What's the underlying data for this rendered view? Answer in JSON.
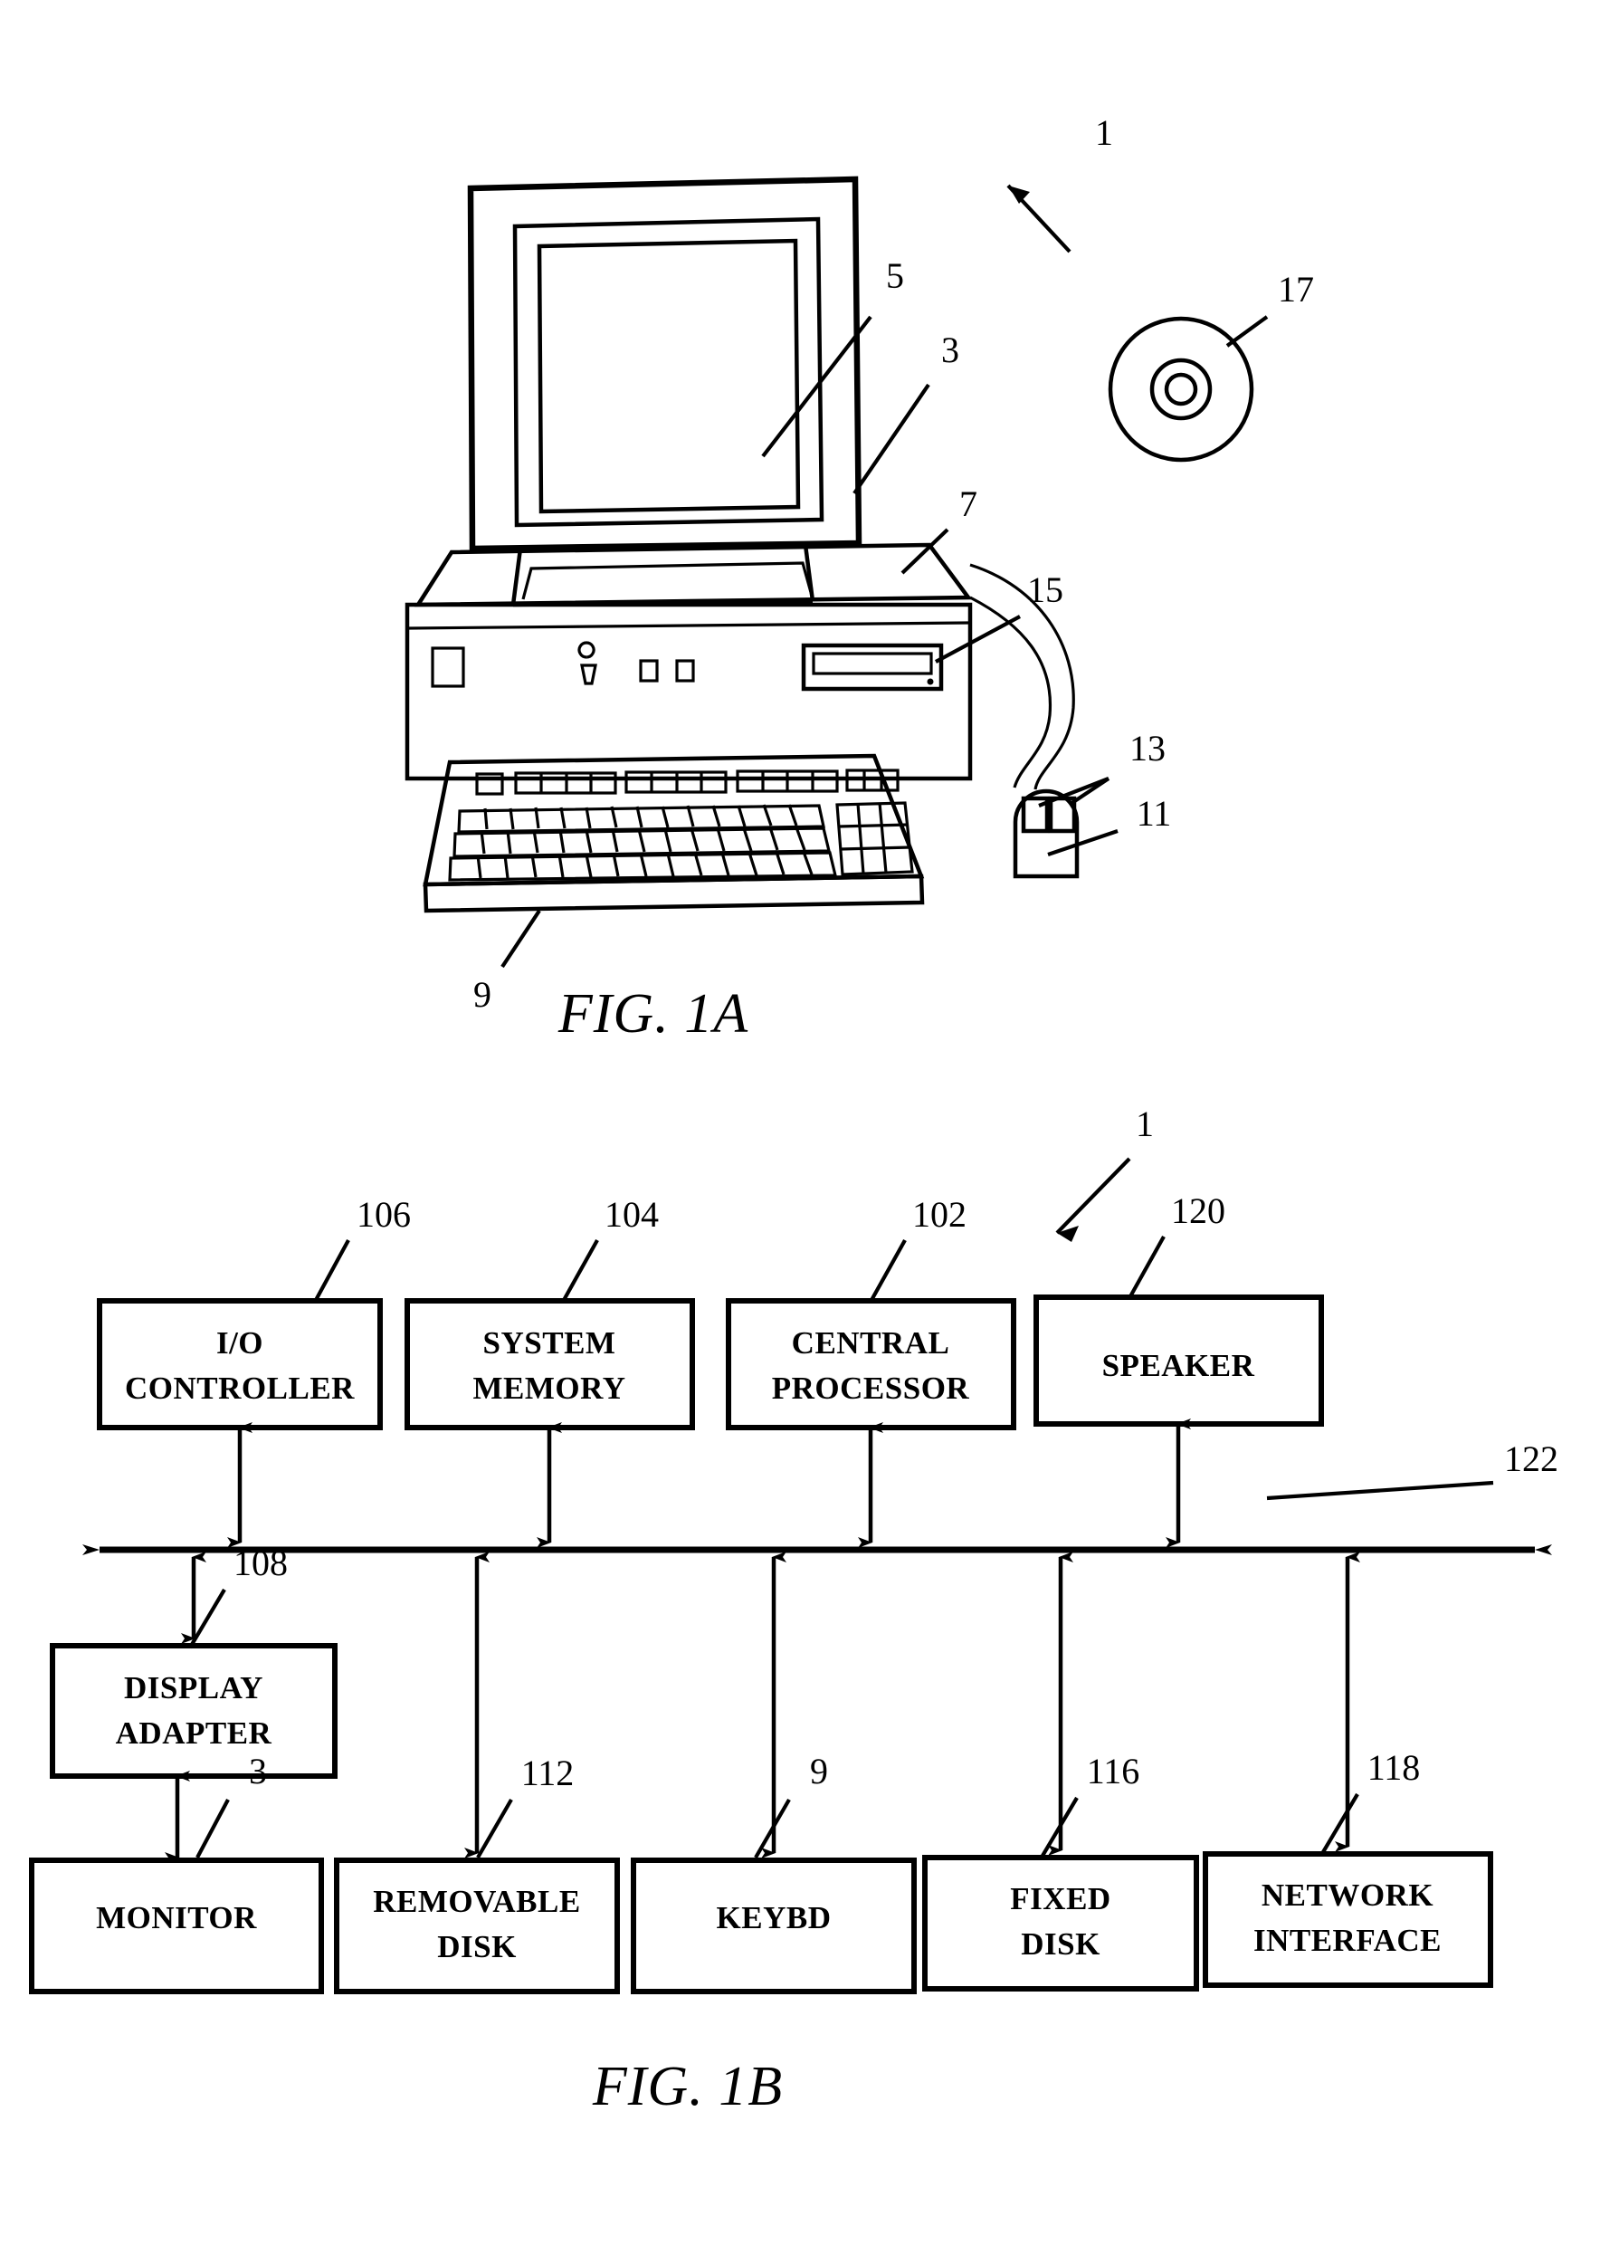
{
  "document": {
    "kind": "patent-drawing-sheet",
    "figures": [
      "FIG. 1A",
      "FIG. 1B"
    ]
  },
  "fig1a": {
    "caption": "FIG. 1A",
    "system_ref": "1",
    "reference_numerals": [
      {
        "id": "1",
        "target": "computer system"
      },
      {
        "id": "3",
        "target": "monitor"
      },
      {
        "id": "5",
        "target": "display screen"
      },
      {
        "id": "7",
        "target": "system unit"
      },
      {
        "id": "9",
        "target": "keyboard"
      },
      {
        "id": "11",
        "target": "mouse"
      },
      {
        "id": "13",
        "target": "mouse buttons"
      },
      {
        "id": "15",
        "target": "removable disk drive"
      },
      {
        "id": "17",
        "target": "optical disc"
      }
    ],
    "parts": {
      "monitor": "3",
      "screen": "5",
      "system_unit": "7",
      "keyboard": "9",
      "mouse": "11",
      "mouse_buttons": "13",
      "drive_slot": "15",
      "disc": "17"
    }
  },
  "fig1b": {
    "caption": "FIG. 1B",
    "system_ref": "1",
    "bus": {
      "label": "122",
      "name": "system bus"
    },
    "top_blocks": [
      {
        "ref": "106",
        "lines": [
          "I/O",
          "CONTROLLER"
        ],
        "name": "io-controller"
      },
      {
        "ref": "104",
        "lines": [
          "SYSTEM",
          "MEMORY"
        ],
        "name": "system-memory"
      },
      {
        "ref": "102",
        "lines": [
          "CENTRAL",
          "PROCESSOR"
        ],
        "name": "central-processor"
      },
      {
        "ref": "120",
        "lines": [
          "SPEAKER"
        ],
        "name": "speaker"
      }
    ],
    "adapter_block": {
      "ref": "108",
      "lines": [
        "DISPLAY",
        "ADAPTER"
      ],
      "name": "display-adapter"
    },
    "bottom_blocks": [
      {
        "ref": "3",
        "lines": [
          "MONITOR"
        ],
        "name": "monitor"
      },
      {
        "ref": "112",
        "lines": [
          "REMOVABLE",
          "DISK"
        ],
        "name": "removable-disk"
      },
      {
        "ref": "9",
        "lines": [
          "KEYBD"
        ],
        "name": "keyboard"
      },
      {
        "ref": "116",
        "lines": [
          "FIXED",
          "DISK"
        ],
        "name": "fixed-disk"
      },
      {
        "ref": "118",
        "lines": [
          "NETWORK",
          "INTERFACE"
        ],
        "name": "network-interface"
      }
    ]
  },
  "colors": {
    "ink": "#000000",
    "paper": "#ffffff"
  }
}
